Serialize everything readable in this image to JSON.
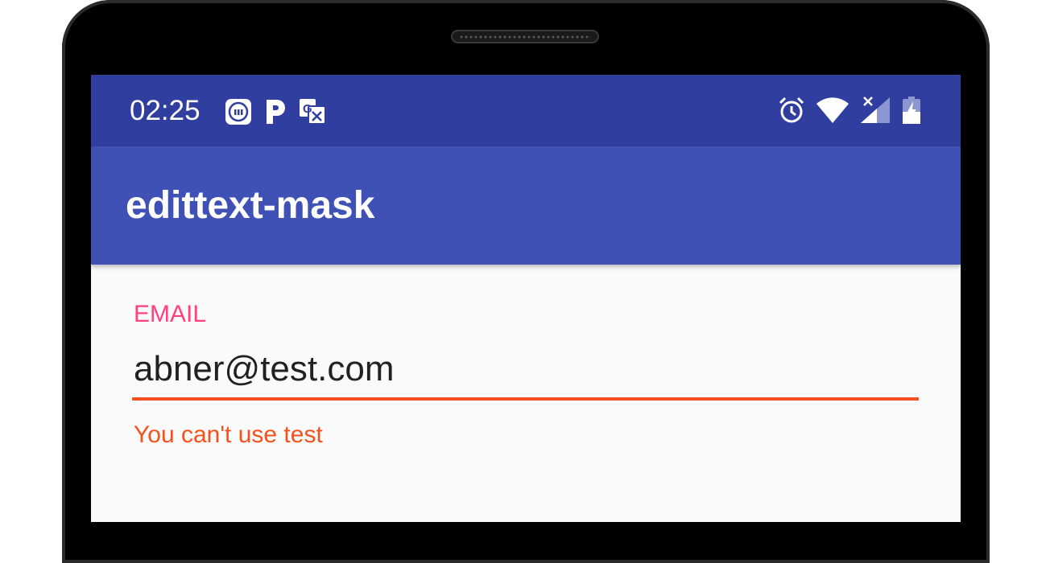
{
  "status_bar": {
    "time": "02:25",
    "notification_icons": [
      "mi-icon",
      "p-icon",
      "translate-icon"
    ],
    "system_icons": [
      "alarm-icon",
      "wifi-icon",
      "signal-no-data-icon",
      "battery-charging-icon"
    ]
  },
  "app_bar": {
    "title": "edittext-mask"
  },
  "email_field": {
    "label": "EMAIL",
    "value": "abner@test.com",
    "error": "You can't use test"
  },
  "colors": {
    "status_bar": "#303f9f",
    "primary": "#3f51b5",
    "accent": "#ff4081",
    "error": "#f4511e",
    "background": "#fafafa"
  }
}
